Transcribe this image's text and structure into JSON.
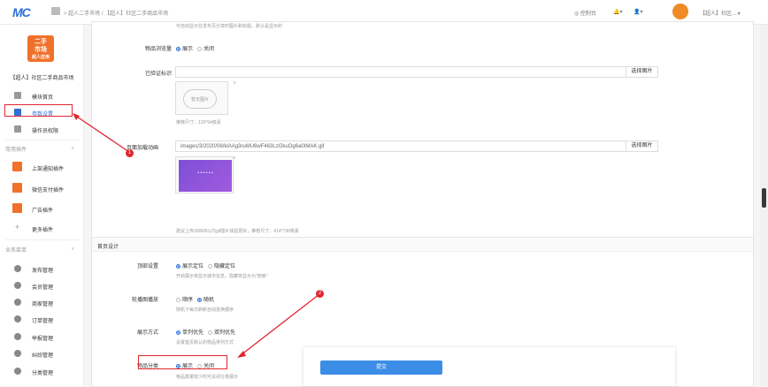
{
  "topbar": {
    "logo": "MC",
    "breadcrumb": "> 超人二手市场 / 【超人】社区二手商品市场",
    "console_label": "控制台",
    "user_label": "【超人】社区..."
  },
  "sidebar": {
    "app_logo_line1": "二手",
    "app_logo_line2": "市场",
    "app_logo_line3": "超人应用",
    "app_name": "【超人】社区二手商品市场",
    "items_top": [
      {
        "label": "模块首页"
      },
      {
        "label": "参数设置"
      },
      {
        "label": "操作员权限"
      }
    ],
    "section_plugins": "常用插件",
    "plugins": [
      {
        "label": "上架通知插件"
      },
      {
        "label": "微信支付插件"
      },
      {
        "label": "广告插件"
      },
      {
        "label": "更多插件"
      }
    ],
    "section_business": "业务菜单",
    "business": [
      {
        "label": "发布管理"
      },
      {
        "label": "会员管理"
      },
      {
        "label": "商家管理"
      },
      {
        "label": "订单管理"
      },
      {
        "label": "举报管理"
      },
      {
        "label": "纠纷管理"
      },
      {
        "label": "分类管理"
      }
    ]
  },
  "form": {
    "top_hint": "可自动显示在发布页分享时图片和标题，默认是显示的",
    "browse_count_label": "物品浏览量",
    "browse_show": "展示",
    "browse_close": "关闭",
    "verified_label": "已验证标识",
    "select_image": "选择图片",
    "no_image": "暂无图片",
    "size_hint_1": "推荐尺寸：120*94像素",
    "loading_label": "页面加载动画",
    "loading_value": "images/3/2020/08/klAAg3ruMU6wF463LzGkuOg6a0IMAK.gif",
    "loading_thumb_text": "• • • • • •",
    "size_hint_2": "建议上传200KB以内gif图片体验更好，推荐尺寸：414*736像素"
  },
  "home_design": {
    "header": "首页设计",
    "top_setting_label": "顶部设置",
    "top_opt1": "展示定位",
    "top_opt2": "隐藏定位",
    "top_hint": "开启展示将显示城市信息，隐藏将显示为\"搜索\"",
    "carousel_label": "轮播图播放",
    "carousel_opt1": "顺序",
    "carousel_opt2": "随机",
    "carousel_hint": "随机下每次刷新自动变换顺序",
    "display_label": "展示方式",
    "display_opt1": "单列优先",
    "display_opt2": "双列优先",
    "display_hint": "设置首页默认的物品排列方式",
    "category_label": "物品分类",
    "category_opt1": "展示",
    "category_opt2": "关闭",
    "category_hint": "物品数量较少时可关闭分类展示"
  },
  "submit_label": "提交",
  "annotations": {
    "marker1": "1",
    "marker2": "2"
  },
  "colors": {
    "accent": "#2d6fd6",
    "orange": "#f0712a",
    "red": "#e0262f",
    "submit": "#3c8de6"
  }
}
